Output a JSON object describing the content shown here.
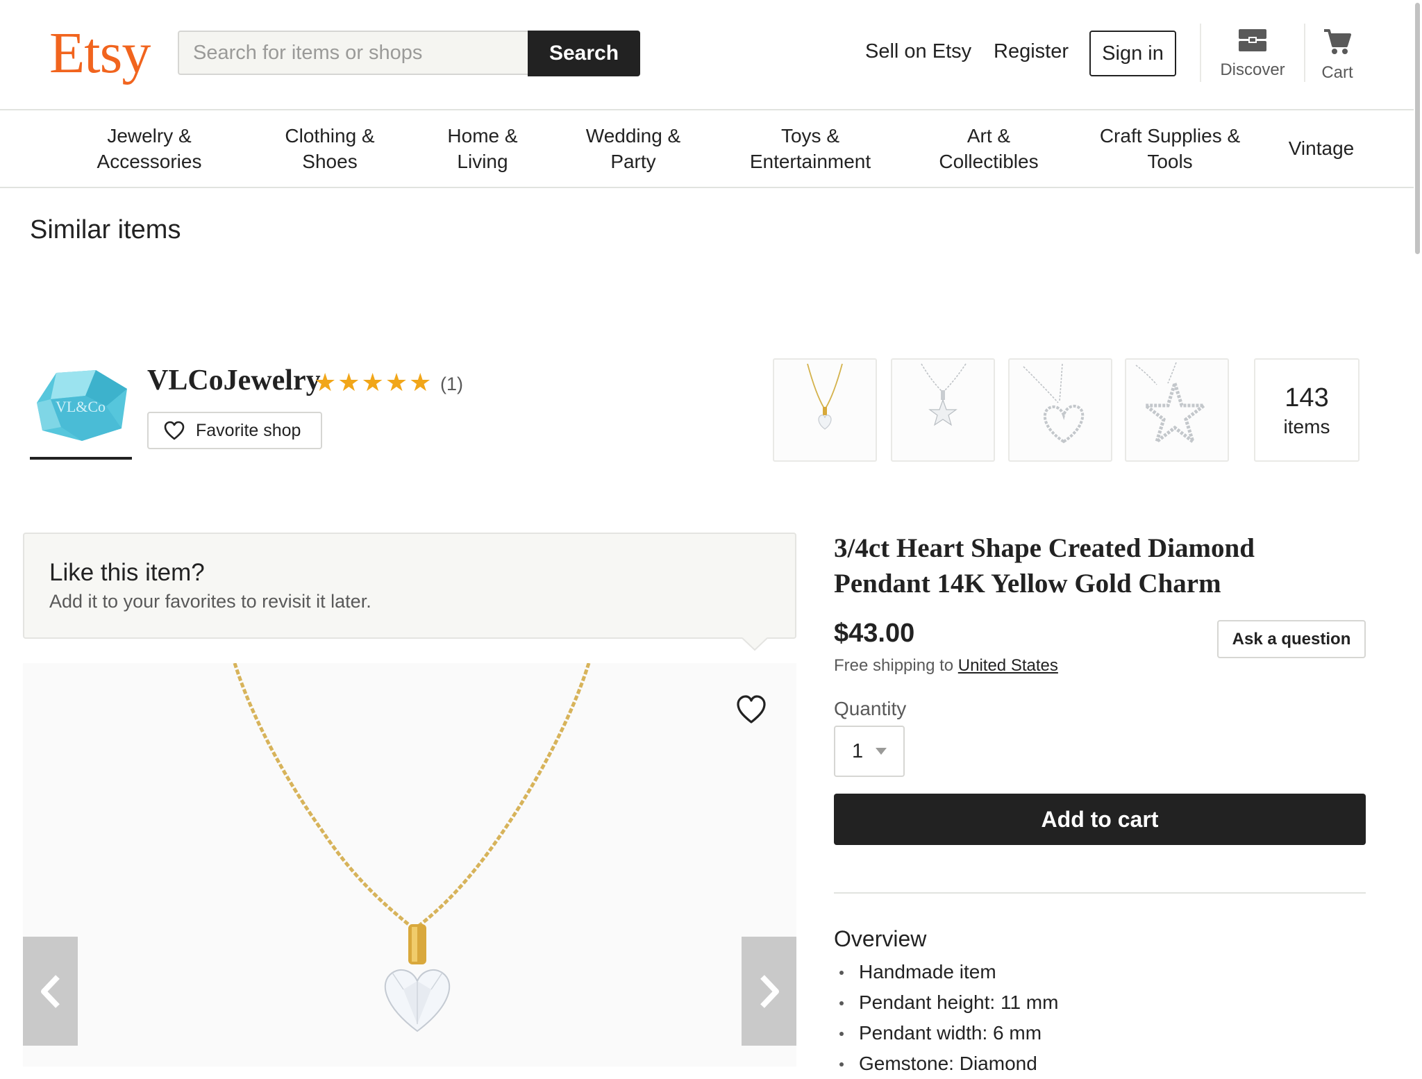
{
  "brand": {
    "logo_text": "Etsy",
    "accent_color": "#f1641e"
  },
  "header": {
    "search_placeholder": "Search for items or shops",
    "search_button": "Search",
    "sell_link": "Sell on Etsy",
    "register_link": "Register",
    "signin_button": "Sign in",
    "discover_label": "Discover",
    "cart_label": "Cart"
  },
  "categories": [
    {
      "line1": "Jewelry &",
      "line2": "Accessories"
    },
    {
      "line1": "Clothing &",
      "line2": "Shoes"
    },
    {
      "line1": "Home &",
      "line2": "Living"
    },
    {
      "line1": "Wedding &",
      "line2": "Party"
    },
    {
      "line1": "Toys &",
      "line2": "Entertainment"
    },
    {
      "line1": "Art &",
      "line2": "Collectibles"
    },
    {
      "line1": "Craft Supplies &",
      "line2": "Tools"
    },
    {
      "line1": "Vintage",
      "line2": ""
    }
  ],
  "similar": {
    "title": "Similar items"
  },
  "shop": {
    "name": "VLCoJewelry",
    "rating_stars": "★★★★★",
    "rating_value": 5,
    "review_count": "(1)",
    "favorite_button": "Favorite shop",
    "avatar_text": "VL&Co",
    "items_count": "143",
    "items_label": "items",
    "thumbnails": [
      "gold-heart-pendant-icon",
      "silver-star-pendant-icon",
      "silver-heart-outline-pendant-icon",
      "silver-star-outline-pendant-icon"
    ]
  },
  "like_banner": {
    "title": "Like this item?",
    "subtitle": "Add it to your favorites to revisit it later."
  },
  "listing": {
    "title": "3/4ct Heart Shape Created Diamond Pendant 14K Yellow Gold Charm",
    "price": "$43.00",
    "shipping_prefix": "Free shipping to ",
    "shipping_country": "United States",
    "ask_button": "Ask a question",
    "quantity_label": "Quantity",
    "quantity_value": "1",
    "add_to_cart": "Add to cart",
    "overview_title": "Overview",
    "overview_items": [
      "Handmade item",
      "Pendant height: 11 mm",
      "Pendant width: 6 mm",
      "Gemstone: Diamond"
    ]
  }
}
